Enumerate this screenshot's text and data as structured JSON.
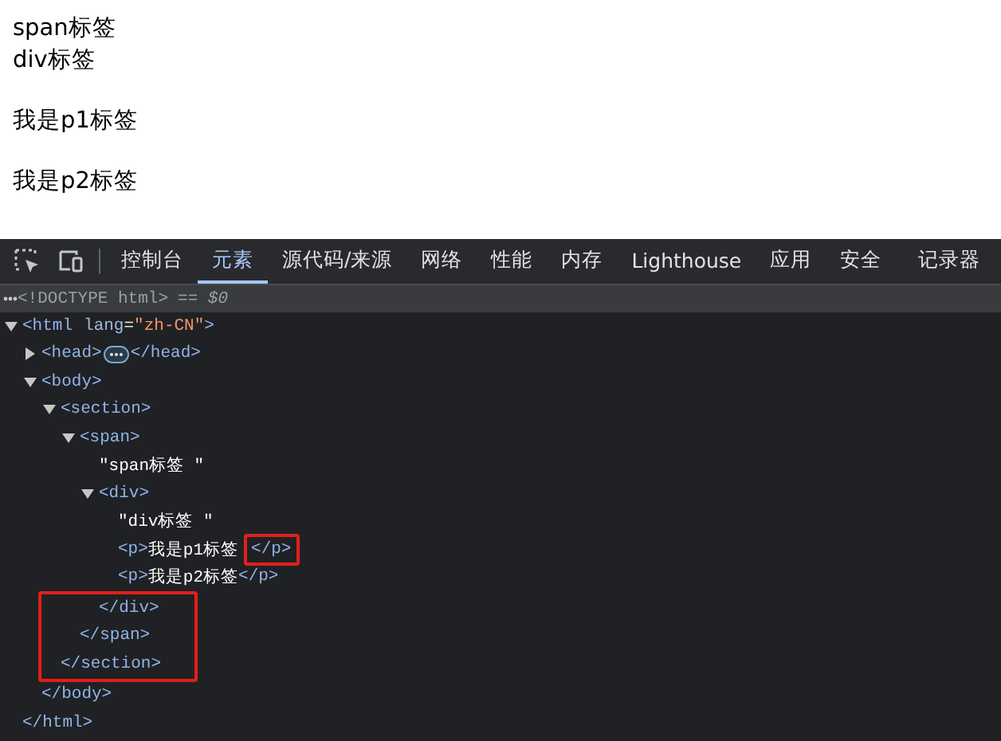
{
  "page": {
    "inline_texts": [
      "span标签",
      "div标签"
    ],
    "paragraphs": [
      "我是p1标签",
      "我是p2标签"
    ]
  },
  "devtools": {
    "tabs": [
      {
        "label": "控制台",
        "selected": false
      },
      {
        "label": "元素",
        "selected": true
      },
      {
        "label": "源代码/来源",
        "selected": false
      },
      {
        "label": "网络",
        "selected": false
      },
      {
        "label": "性能",
        "selected": false
      },
      {
        "label": "内存",
        "selected": false
      },
      {
        "label": "Lighthouse",
        "selected": false
      },
      {
        "label": "应用",
        "selected": false
      },
      {
        "label": "安全",
        "selected": false
      },
      {
        "label": "记录器",
        "selected": false
      }
    ],
    "doctype": {
      "text": "<!DOCTYPE html>",
      "reference": "== $0",
      "selected": true
    },
    "tree": [
      {
        "open": [
          {
            "kind": "tag",
            "text": "<html"
          },
          {
            "kind": "attr",
            "text": "lang"
          },
          {
            "kind": "punct",
            "text": "="
          },
          {
            "kind": "value",
            "text": "\"zh-CN\""
          },
          {
            "kind": "tag",
            "text": ">"
          }
        ],
        "expanded": true,
        "close": [
          {
            "kind": "tag",
            "text": "</html>"
          }
        ],
        "children": [
          {
            "open": [
              {
                "kind": "tag",
                "text": "<head>"
              }
            ],
            "expanded": false,
            "close": [
              {
                "kind": "tag",
                "text": "</head>"
              }
            ]
          },
          {
            "open": [
              {
                "kind": "tag",
                "text": "<body>"
              }
            ],
            "expanded": true,
            "close": [
              {
                "kind": "tag",
                "text": "</body>"
              }
            ],
            "children": [
              {
                "open": [
                  {
                    "kind": "tag",
                    "text": "<section>"
                  }
                ],
                "expanded": true,
                "close": [
                  {
                    "kind": "tag",
                    "text": "</section>"
                  }
                ],
                "close_boxed": true,
                "children": [
                  {
                    "open": [
                      {
                        "kind": "tag",
                        "text": "<span>"
                      }
                    ],
                    "expanded": true,
                    "close": [
                      {
                        "kind": "tag",
                        "text": "</span>"
                      }
                    ],
                    "close_boxed": true,
                    "children": [
                      {
                        "open": [
                          {
                            "kind": "text",
                            "text": "\"span标签 \""
                          }
                        ]
                      },
                      {
                        "open": [
                          {
                            "kind": "tag",
                            "text": "<div>"
                          }
                        ],
                        "expanded": true,
                        "close": [
                          {
                            "kind": "tag",
                            "text": "</div>"
                          }
                        ],
                        "close_boxed": true,
                        "children": [
                          {
                            "open": [
                              {
                                "kind": "text",
                                "text": "\"div标签 \""
                              }
                            ]
                          },
                          {
                            "open": [
                              {
                                "kind": "tag",
                                "text": "<p>"
                              },
                              {
                                "kind": "text",
                                "text": "我是p1标签"
                              },
                              {
                                "kind": "tag",
                                "text": "</p>",
                                "boxed": true
                              }
                            ]
                          },
                          {
                            "open": [
                              {
                                "kind": "tag",
                                "text": "<p>"
                              },
                              {
                                "kind": "text",
                                "text": "我是p2标签"
                              },
                              {
                                "kind": "tag",
                                "text": "</p>"
                              }
                            ]
                          }
                        ]
                      }
                    ]
                  }
                ]
              }
            ]
          }
        ]
      }
    ]
  }
}
